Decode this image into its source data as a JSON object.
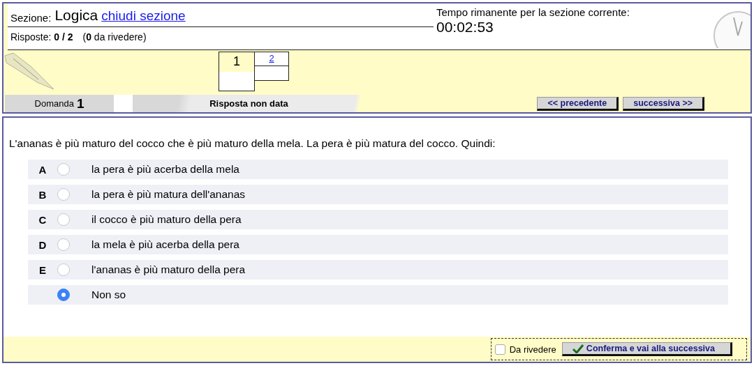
{
  "header": {
    "section_label": "Sezione:",
    "section_name": "Logica",
    "close_link": "chiudi sezione",
    "answers_label": "Risposte:",
    "answers_value": "0 / 2",
    "review_open": "(",
    "review_count": "0",
    "review_rest": "da rivedere)",
    "timer_label": "Tempo rimanente per la sezione corrente:",
    "timer_value": "00:02:53"
  },
  "question_nav": [
    {
      "number": "1",
      "selected": true
    },
    {
      "number": "2",
      "selected": false
    }
  ],
  "status_bar": {
    "question_label": "Domanda",
    "question_number": "1",
    "answer_status": "Risposta non data",
    "prev_button": "<< precedente",
    "next_button": "successiva >>"
  },
  "question": {
    "text": "L'ananas è più maturo del cocco che è più maturo della mela. La pera è più matura del cocco. Quindi:",
    "options": [
      {
        "letter": "A",
        "text": "la pera è più acerba della mela",
        "selected": false
      },
      {
        "letter": "B",
        "text": "la pera è più matura dell'ananas",
        "selected": false
      },
      {
        "letter": "C",
        "text": "il cocco è più maturo della pera",
        "selected": false
      },
      {
        "letter": "D",
        "text": "la mela è più acerba della pera",
        "selected": false
      },
      {
        "letter": "E",
        "text": "l'ananas è più maturo della pera",
        "selected": false
      },
      {
        "text": "Non so",
        "selected": true
      }
    ]
  },
  "footer": {
    "review_checkbox": {
      "label": "Da rivedere",
      "checked": false
    },
    "confirm_button": "Conferma e vai alla successiva"
  }
}
